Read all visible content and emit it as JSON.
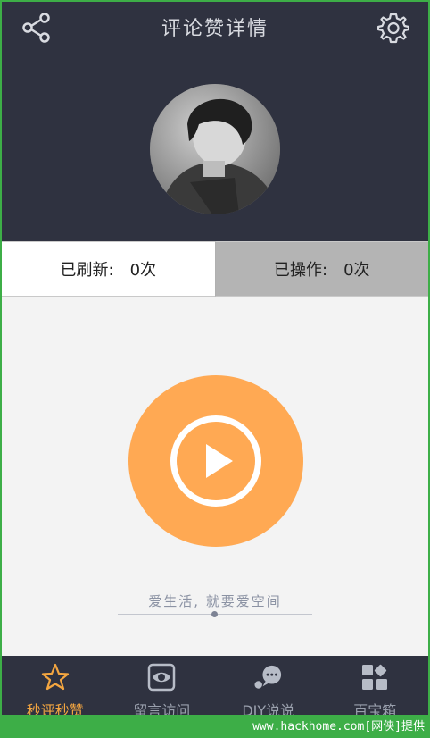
{
  "header": {
    "title": "评论赞详情",
    "share_icon": "share-icon",
    "settings_icon": "gear-icon"
  },
  "stats": {
    "refreshed_label": "已刷新:",
    "refreshed_value": "0次",
    "operated_label": "已操作:",
    "operated_value": "0次"
  },
  "main": {
    "play_icon": "play-icon",
    "slogan": "爱生活, 就要爱空间"
  },
  "tabs": [
    {
      "label": "秒评秒赞",
      "icon": "star-icon",
      "active": true
    },
    {
      "label": "留言访问",
      "icon": "eye-icon",
      "active": false
    },
    {
      "label": "DIY说说",
      "icon": "chat-icon",
      "active": false
    },
    {
      "label": "百宝箱",
      "icon": "grid-icon",
      "active": false
    }
  ],
  "colors": {
    "header_bg": "#2f3240",
    "accent": "#ffa953",
    "active_tab": "#f4a640"
  },
  "watermark": "www.hackhome.com[网侠]提供"
}
